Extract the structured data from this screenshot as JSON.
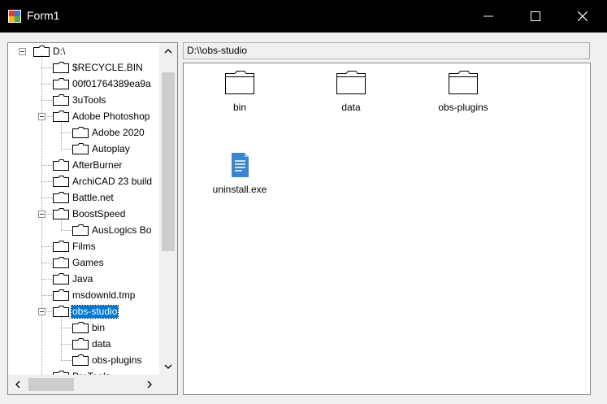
{
  "window": {
    "title": "Form1"
  },
  "titlebar": {
    "minimize_glyph": "─",
    "maximize_glyph": "☐",
    "close_glyph": "✕"
  },
  "tree": {
    "root": "D:\\",
    "nodes": [
      {
        "label": "$RECYCLE.BIN",
        "level": 1,
        "expanded": false
      },
      {
        "label": "00f01764389ea9a",
        "level": 1,
        "expanded": false
      },
      {
        "label": "3uTools",
        "level": 1,
        "expanded": false
      },
      {
        "label": "Adobe Photoshop",
        "level": 1,
        "expanded": true
      },
      {
        "label": "Adobe 2020",
        "level": 2,
        "expanded": false
      },
      {
        "label": "Autoplay",
        "level": 2,
        "expanded": false
      },
      {
        "label": "AfterBurner",
        "level": 1,
        "expanded": false
      },
      {
        "label": "ArchiCAD 23 build",
        "level": 1,
        "expanded": false
      },
      {
        "label": "Battle.net",
        "level": 1,
        "expanded": false
      },
      {
        "label": "BoostSpeed",
        "level": 1,
        "expanded": true
      },
      {
        "label": "AusLogics Bo",
        "level": 2,
        "expanded": false
      },
      {
        "label": "Films",
        "level": 1,
        "expanded": false
      },
      {
        "label": "Games",
        "level": 1,
        "expanded": false
      },
      {
        "label": "Java",
        "level": 1,
        "expanded": false
      },
      {
        "label": "msdownld.tmp",
        "level": 1,
        "expanded": false
      },
      {
        "label": "obs-studio",
        "level": 1,
        "expanded": true,
        "selected": true
      },
      {
        "label": "bin",
        "level": 2,
        "expanded": false
      },
      {
        "label": "data",
        "level": 2,
        "expanded": false
      },
      {
        "label": "obs-plugins",
        "level": 2,
        "expanded": false
      },
      {
        "label": "ProTools",
        "level": 1,
        "expanded": false
      }
    ]
  },
  "path": {
    "value": "D:\\\\obs-studio"
  },
  "files": [
    {
      "name": "bin",
      "type": "folder"
    },
    {
      "name": "data",
      "type": "folder"
    },
    {
      "name": "obs-plugins",
      "type": "folder"
    },
    {
      "name": "uninstall.exe",
      "type": "file"
    }
  ],
  "colors": {
    "selection": "#0078d7",
    "file_icon": "#3b86d1"
  }
}
